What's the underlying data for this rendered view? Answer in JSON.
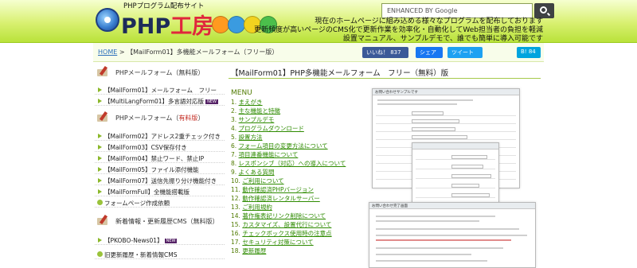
{
  "header": {
    "logo_tagline": "PHPプログラム配布サイト",
    "logo_text_php": "PHP",
    "logo_text_kobo": "工房",
    "search_placeholder": "ENHANCED BY Google",
    "tagline_lines": [
      "現在のホームページに組み込める様々なプログラムを配布しております",
      "更新頻度が高いページのCMS化で更新作業を効率化・自動化してWeb担当者の負担を軽減",
      "設置マニュアル、サンプルデモで、誰でも簡単に導入可能です"
    ],
    "ball_colors": [
      "#ff9a1f",
      "#3a9be0",
      "#f2d21f",
      "#4bbf4b"
    ]
  },
  "breadcrumb": {
    "home": "HOME",
    "sep": ">",
    "current": "【MailForm01】多機能メールフォーム（フリー版）"
  },
  "social": {
    "fb": "いいね！ 837",
    "share": "シェア",
    "tweet": "ツイート",
    "hatena": "B! 84"
  },
  "sidebar": {
    "sec1": "PHPメールフォーム（無料版）",
    "sec1_items": [
      "【MailForm01】メールフォーム　フリー",
      "【MultiLangForm01】多言語対応版"
    ],
    "sec1_badge": "NEW",
    "sec2_prefix": "PHPメールフォーム（",
    "sec2_red": "有料版",
    "sec2_suffix": "）",
    "sec2_items": [
      "【MailForm02】アドレス2重チェック付き",
      "【MailForm03】CSV保存付き",
      "【MailForm04】禁止ワード、禁止IP",
      "【MailForm05】ファイル添付機能",
      "【MailForm07】送信先振り分け機能付き",
      "【MailFormFull】全機能搭載版",
      "フォームページ作成依頼"
    ],
    "sec3": "新着情報・更新履歴CMS（無料版）",
    "sec3_items": [
      "【PKOBO-News01】",
      "旧更新履歴・新着情報CMS"
    ],
    "sec3_badge": "NEW"
  },
  "content": {
    "title": "【MailForm01】PHP多機能メールフォーム　フリー（無料）版",
    "menu_heading": "MENU",
    "menu": [
      {
        "num": "1.",
        "label": "まえがき"
      },
      {
        "num": "2.",
        "label": "主な機能と特徴"
      },
      {
        "num": "3.",
        "label": "サンプルデモ"
      },
      {
        "num": "4.",
        "label": "プログラムダウンロード"
      },
      {
        "num": "5.",
        "label": "設置方法"
      },
      {
        "num": "6.",
        "label": "フォーム項目の変更方法について"
      },
      {
        "num": "7.",
        "label": "項目連番機能について"
      },
      {
        "num": "8.",
        "label": "レスポンシブ（対応）への導入について"
      },
      {
        "num": "9.",
        "label": "よくある質問"
      },
      {
        "num": "10.",
        "label": "ご利用について"
      },
      {
        "num": "11.",
        "label": "動作確認済PHPバージョン"
      },
      {
        "num": "12.",
        "label": "動作確認済レンタルサーバー"
      },
      {
        "num": "13.",
        "label": "ご利用規約"
      },
      {
        "num": "14.",
        "label": "著作権表記リンク削除について"
      },
      {
        "num": "15.",
        "label": "カスタマイズ、設置代行について"
      },
      {
        "num": "16.",
        "label": "チェックボックス使用時の注意点"
      },
      {
        "num": "17.",
        "label": "セキュリティ対策について"
      },
      {
        "num": "18.",
        "label": "更新履歴"
      }
    ],
    "preview1_title": "お問い合わせサンプルです",
    "preview2_title": "お問い合わせ完了画面"
  }
}
